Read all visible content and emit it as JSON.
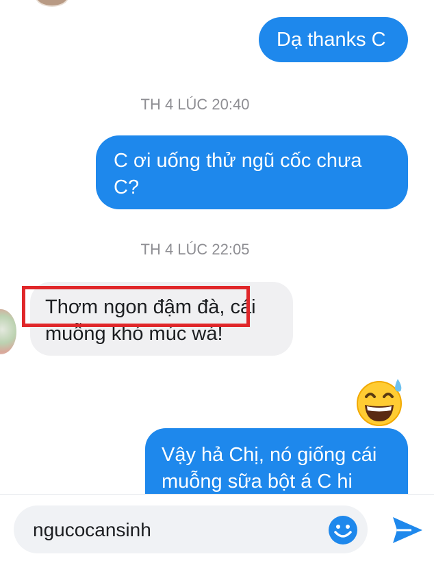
{
  "messages": [
    {
      "direction": "outgoing",
      "text": "Dạ thanks C"
    },
    {
      "direction": "outgoing",
      "text": "C ơi uống thử ngũ cốc chưa C?"
    },
    {
      "direction": "incoming",
      "text": "Thơm ngon đậm đà, cái muỗng khó múc wá!"
    },
    {
      "direction": "outgoing",
      "text": "Vậy hả Chị, nó giống cái muỗng sữa bột á C hi"
    }
  ],
  "timestamps": [
    "TH 4 LÚC 20:40",
    "TH 4 LÚC 22:05"
  ],
  "reaction_emoji": "grinning-face-with-sweat-icon",
  "composer": {
    "value": "ngucocansinh"
  },
  "colors": {
    "outgoing_bubble": "#1e88ec",
    "incoming_bubble": "#f0f0f2",
    "highlight": "#e0272a",
    "accent": "#1e88ec"
  }
}
